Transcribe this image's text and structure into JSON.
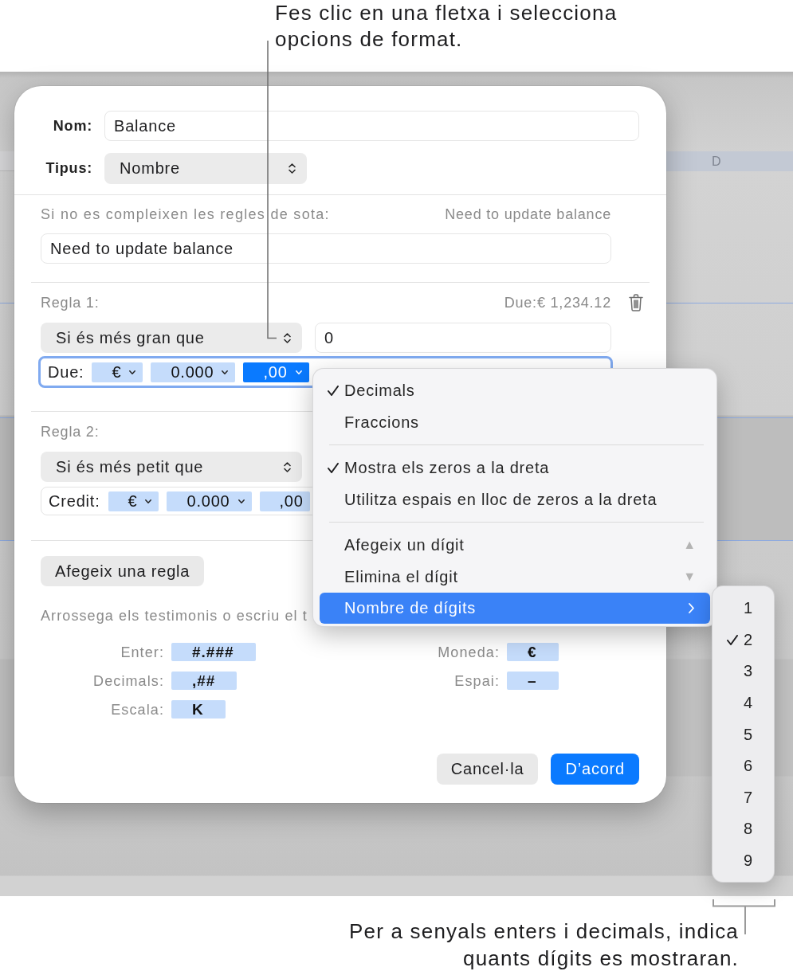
{
  "top_callout": "Fes clic en una fletxa i selecciona opcions de format.",
  "background": {
    "column_header": "D"
  },
  "dialog": {
    "name_field": {
      "label": "Nom:",
      "value": "Balance"
    },
    "type_field": {
      "label": "Tipus:",
      "value": "Nombre"
    },
    "fallback": {
      "label": "Si no es compleixen les regles de sota:",
      "preview": "Need to update balance",
      "value": "Need to update balance"
    },
    "rules": [
      {
        "title": "Regla 1:",
        "preview": "Due:€ 1,234.12",
        "show_delete": true,
        "condition": "Si és més gran que",
        "value": "0",
        "focused": true,
        "format_label": "Due:",
        "tokens": [
          {
            "text": "€",
            "selected": false,
            "chevron": true
          },
          {
            "text": "0.000",
            "selected": false,
            "chevron": true
          },
          {
            "text": ",00",
            "selected": true,
            "chevron": true
          }
        ]
      },
      {
        "title": "Regla 2:",
        "condition": "Si és més petit que",
        "focused": false,
        "format_label": "Credit:",
        "tokens": [
          {
            "text": "€",
            "selected": false,
            "chevron": true
          },
          {
            "text": "0.000",
            "selected": false,
            "chevron": true
          },
          {
            "text": ",00",
            "selected": false,
            "chevron": false
          }
        ]
      }
    ],
    "add_rule_button": "Afegeix una regla",
    "hint": "Arrossega els testimonis o escriu el t",
    "token_palette": {
      "left": [
        {
          "label": "Enter:",
          "token": "#.###"
        },
        {
          "label": "Decimals:",
          "token": ",##"
        },
        {
          "label": "Escala:",
          "token": "K"
        }
      ],
      "right": [
        {
          "label": "Moneda:",
          "token": "€"
        },
        {
          "label": "Espai:",
          "token": "–"
        }
      ]
    },
    "buttons": [
      {
        "label": "Cancel·la",
        "kind": "secondary"
      },
      {
        "label": "D’acord",
        "kind": "primary"
      }
    ]
  },
  "format_menu": {
    "items": [
      {
        "kind": "item",
        "label": "Decimals",
        "checked": true,
        "selected": false
      },
      {
        "kind": "item",
        "label": "Fraccions",
        "checked": false,
        "selected": false
      },
      {
        "kind": "separator"
      },
      {
        "kind": "item",
        "label": "Mostra els zeros a la dreta",
        "checked": true,
        "selected": false
      },
      {
        "kind": "item",
        "label": "Utilitza espais en lloc de zeros a la dreta",
        "checked": false,
        "selected": false
      },
      {
        "kind": "separator"
      },
      {
        "kind": "item",
        "label": "Afegeix un dígit",
        "checked": false,
        "selected": false,
        "shortcut": "▲"
      },
      {
        "kind": "item",
        "label": "Elimina el dígit",
        "checked": false,
        "selected": false,
        "shortcut": "▼"
      },
      {
        "kind": "submenu",
        "label": "Nombre de dígits",
        "checked": false,
        "selected": true
      }
    ]
  },
  "digits_menu": {
    "items": [
      {
        "label": "1",
        "checked": false
      },
      {
        "label": "2",
        "checked": true
      },
      {
        "label": "3",
        "checked": false
      },
      {
        "label": "4",
        "checked": false
      },
      {
        "label": "5",
        "checked": false
      },
      {
        "label": "6",
        "checked": false
      },
      {
        "label": "7",
        "checked": false
      },
      {
        "label": "8",
        "checked": false
      },
      {
        "label": "9",
        "checked": false
      }
    ]
  },
  "bottom_callout": "Per a senyals enters i decimals, indica quants dígits es mostraran."
}
